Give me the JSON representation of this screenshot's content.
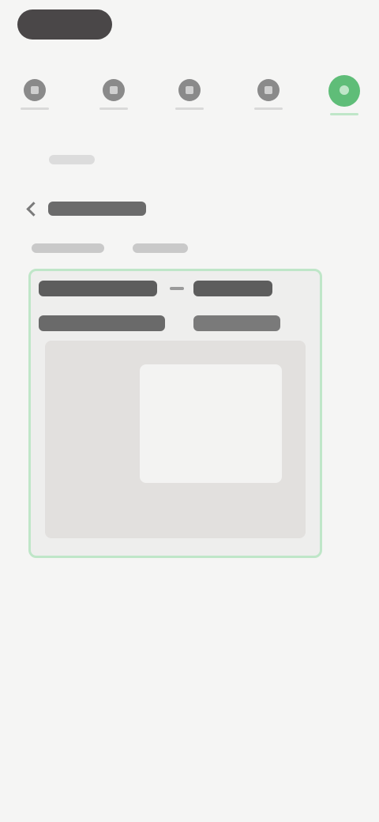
{
  "top_pill": {
    "label": ""
  },
  "steps": [
    {
      "label": "",
      "icon": "square-icon",
      "active": false
    },
    {
      "label": "",
      "icon": "square-icon",
      "active": false
    },
    {
      "label": "",
      "icon": "square-icon",
      "active": false
    },
    {
      "label": "",
      "icon": "square-icon",
      "active": false
    },
    {
      "label": "",
      "icon": "circle-icon",
      "active": true
    }
  ],
  "hint": {
    "text": ""
  },
  "page": {
    "title": "",
    "subtitle_left": "",
    "subtitle_right": ""
  },
  "board": {
    "row1_left": "",
    "row1_right": "",
    "row2_left": "",
    "row2_right": ""
  },
  "colors": {
    "accent": "#5fbd78",
    "accent_light": "#bfe6c8",
    "pill": "#4a4748",
    "background": "#f5f5f4"
  }
}
